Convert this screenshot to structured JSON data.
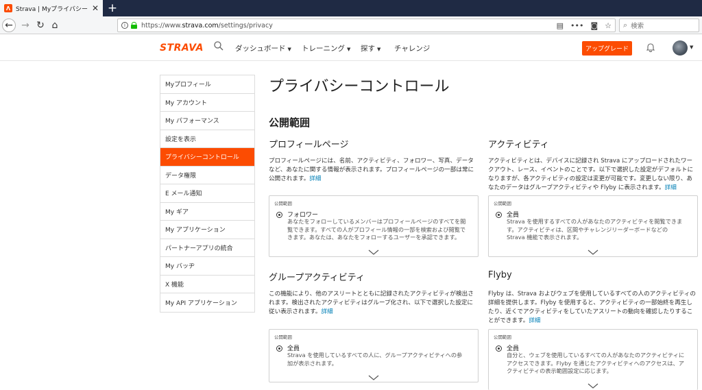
{
  "browser": {
    "tab_title": "Strava | Myプライバシー",
    "favicon_letter": "✓",
    "url_prefix": "https://www.",
    "url_domain": "strava.com",
    "url_path": "/settings/privacy",
    "search_placeholder": "検索"
  },
  "header": {
    "logo": "STRAVA",
    "menus": [
      "ダッシュボード",
      "トレーニング",
      "探す",
      "チャレンジ"
    ],
    "upgrade_label": "アップグレード"
  },
  "sidebar": {
    "items": [
      {
        "label": "Myプロフィール"
      },
      {
        "label": "My アカウント"
      },
      {
        "label": "My パフォーマンス"
      },
      {
        "label": "設定を表示"
      },
      {
        "label": "プライバシーコントロール"
      },
      {
        "label": "データ権限"
      },
      {
        "label": "E メール通知"
      },
      {
        "label": "My ギア"
      },
      {
        "label": "My アプリケーション"
      },
      {
        "label": "パートナーアプリの統合"
      },
      {
        "label": "My バッヂ"
      },
      {
        "label": "X 機能"
      },
      {
        "label": "My API アプリケーション"
      }
    ],
    "active_index": 4
  },
  "main": {
    "page_title": "プライバシーコントロール",
    "section_title": "公開範囲",
    "more_label": "詳細",
    "blocks": {
      "profile": {
        "title": "プロフィールページ",
        "desc": "プロフィールページには、名前、アクティビティ、フォロワー、写真、データなど、あなたに関する情報が表示されます。プロフィールページの一部は常に公開されます。",
        "box_label": "公開範囲",
        "option": "フォロワー",
        "option_desc": "あなたをフォローしているメンバーはプロフィールページのすべてを閲覧できます。すべての人がプロフィール情報の一部を検索および閲覧できます。あなたは、あなたをフォローするユーザーを承認できます。"
      },
      "activity": {
        "title": "アクティビティ",
        "desc": "アクティビティとは、デバイスに記録され Strava にアップロードされたワークアウト、レース、イベントのことです。以下で選択した設定がデフォルトになりますが、各アクティビティの設定は変更が可能です。変更しない限り、あなたのデータはグループアクティビティや Flyby に表示されます。",
        "box_label": "公開範囲",
        "option": "全員",
        "option_desc": "Strava を使用するすべての人があなたのアクティビティを閲覧できます。アクティビティは、区間やチャレンジリーダーボードなどの Strava 機能で表示されます。"
      },
      "group": {
        "title": "グループアクティビティ",
        "desc": "この機能により、他のアスリートとともに記録されたアクティビティが検出されます。検出されたアクティビティはグループ化され、以下で選択した設定に従い表示されます。",
        "box_label": "公開範囲",
        "option": "全員",
        "option_desc": "Strava を使用しているすべての人に、グループアクティビティへの参加が表示されます。"
      },
      "flyby": {
        "title": "Flyby",
        "desc": "Flyby は、Strava およびウェブを使用しているすべての人のアクティビティの詳細を提供します。Flyby を使用すると、アクティビティの一部始終を再生したり、近くでアクティビティをしていたアスリートの動向を確認したりすることができます。",
        "box_label": "公開範囲",
        "option": "全員",
        "option_desc": "自分と、ウェブを使用しているすべての人があなたのアクティビティにアクセスできます。Flyby を通じたアクティビティへのアクセスは、アクティビティの表示範囲設定に応じます。"
      }
    }
  }
}
